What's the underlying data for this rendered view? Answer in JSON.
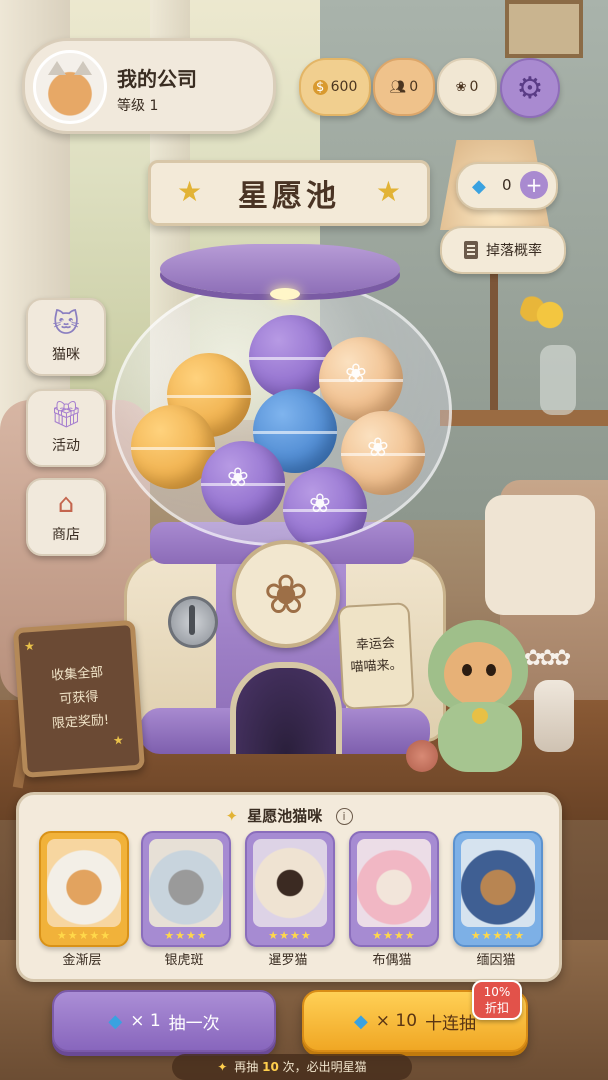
{
  "profile": {
    "name": "我的公司",
    "level": "等级 1",
    "avatar_icon": "cat-avatar-icon"
  },
  "resources": {
    "coins": "600",
    "people": "0",
    "paws": "0",
    "coin_icon_text": "$"
  },
  "title": "星愿池",
  "gems": {
    "count": "0",
    "plus": "+"
  },
  "drop_rate_label": "掉落概率",
  "nav": [
    {
      "label": "猫咪",
      "icon": "cat-face-icon"
    },
    {
      "label": "活动",
      "icon": "gift-icon"
    },
    {
      "label": "商店",
      "icon": "shop-icon"
    }
  ],
  "machine": {
    "tag_lines": [
      "幸运会",
      "喵喵来。"
    ]
  },
  "sign": {
    "lines": [
      "收集全部",
      "可获得",
      "限定奖励!"
    ]
  },
  "pool": {
    "header": "星愿池猫咪",
    "info": "i",
    "cats": [
      {
        "name": "金渐层",
        "stars": "★★★★★",
        "rarity_color": "#f1b23a"
      },
      {
        "name": "银虎斑",
        "stars": "★★★★",
        "rarity_color": "#a68bd2"
      },
      {
        "name": "暹罗猫",
        "stars": "★★★★",
        "rarity_color": "#a68bd2"
      },
      {
        "name": "布偶猫",
        "stars": "★★★★",
        "rarity_color": "#a68bd2"
      },
      {
        "name": "缅因猫",
        "stars": "★★★★★",
        "rarity_color": "#7db0e6"
      }
    ]
  },
  "buttons": {
    "single": {
      "mult": "× 1",
      "label": "抽一次"
    },
    "ten": {
      "mult": "× 10",
      "label": "十连抽"
    },
    "discount_pct": "10%",
    "discount_label": "折扣"
  },
  "pity": {
    "prefix": "再抽",
    "count": "10",
    "suffix": "次，必出明星猫"
  },
  "colors": {
    "accent_purple": "#a98ad0",
    "accent_gold": "#f0a724",
    "gem_blue": "#3aa2e0"
  }
}
